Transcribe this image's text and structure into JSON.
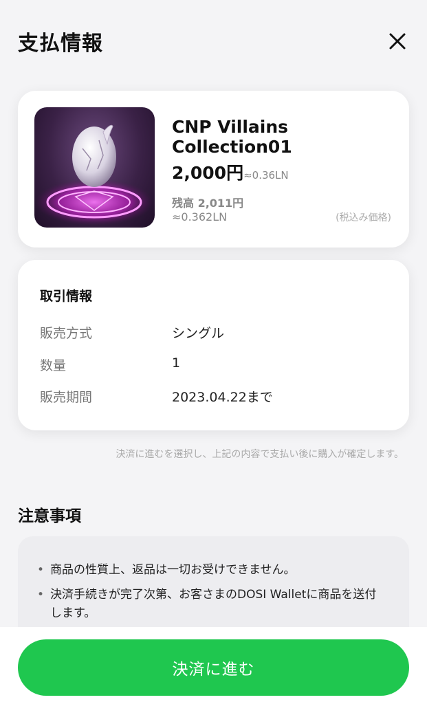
{
  "header": {
    "title": "支払情報"
  },
  "product": {
    "name": "CNP Villains Collection01",
    "price": "2,000円",
    "price_ln": "≈0.36LN",
    "balance": "残高 2,011円",
    "balance_ln": "≈0.362LN",
    "tax_note": "(税込み価格)"
  },
  "transaction": {
    "title": "取引情報",
    "rows": [
      {
        "label": "販売方式",
        "value": "シングル"
      },
      {
        "label": "数量",
        "value": "1"
      },
      {
        "label": "販売期間",
        "value": "2023.04.22まで"
      }
    ]
  },
  "confirm_notice": "決済に進むを選択し、上記の内容で支払い後に購入が確定します。",
  "caution": {
    "title": "注意事項",
    "items": [
      "商品の性質上、返品は一切お受けできません。",
      "決済手続きが完了次第、お客さまのDOSI Walletに商品を送付します。"
    ]
  },
  "footer": {
    "pay_label": "決済に進む"
  },
  "colors": {
    "accent": "#1fc74f",
    "background": "#f4f4f6",
    "card": "#ffffff"
  }
}
